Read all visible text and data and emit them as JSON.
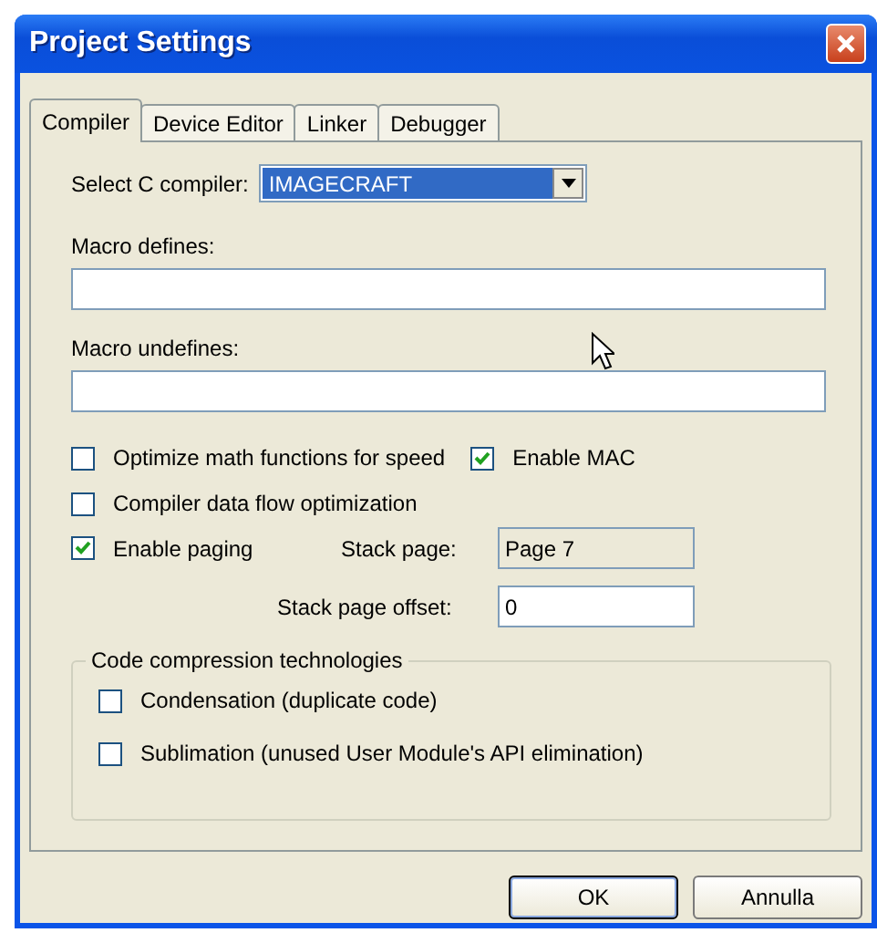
{
  "window": {
    "title": "Project Settings"
  },
  "tabs": [
    {
      "label": "Compiler",
      "selected": true
    },
    {
      "label": "Device Editor",
      "selected": false
    },
    {
      "label": "Linker",
      "selected": false
    },
    {
      "label": "Debugger",
      "selected": false
    }
  ],
  "compiler_select": {
    "label": "Select C compiler:",
    "value": "IMAGECRAFT"
  },
  "macro_defines": {
    "label": "Macro defines:"
  },
  "macro_undefines": {
    "label": "Macro undefines:"
  },
  "options": [
    {
      "label": "Optimize math functions for speed",
      "checked": false
    },
    {
      "label": "Enable MAC",
      "checked": true
    },
    {
      "label": "Compiler data flow optimization",
      "checked": false
    },
    {
      "label": "Enable paging",
      "checked": true
    }
  ],
  "stack_page": {
    "label": "Stack page:",
    "value": "Page 7",
    "disabled": true
  },
  "stack_page_offset": {
    "label": "Stack page offset:",
    "value": "0",
    "disabled": false
  },
  "compression": {
    "title": "Code compression technologies",
    "options": [
      {
        "label": "Condensation (duplicate code)",
        "checked": false
      },
      {
        "label": "Sublimation (unused User Module's API elimination)",
        "checked": false
      }
    ]
  },
  "buttons": [
    {
      "label": "OK",
      "default": true
    },
    {
      "label": "Annulla",
      "default": false
    }
  ]
}
